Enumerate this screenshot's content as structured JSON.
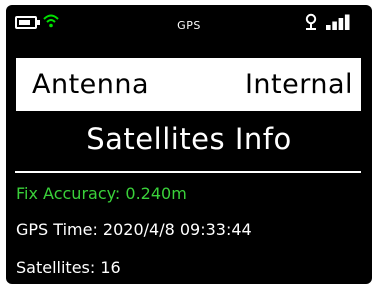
{
  "status_bar": {
    "title": "GPS",
    "battery_level": 0.8,
    "signal_bars": 4,
    "wifi_color": "#00e000"
  },
  "antenna": {
    "label": "Antenna",
    "value": "Internal"
  },
  "section_title": "Satellites Info",
  "info": {
    "fix_accuracy": "Fix Accuracy: 0.240m",
    "fix_color": "#3ad13a",
    "gps_time": "GPS Time: 2020/4/8 09:33:44",
    "satellites": "Satellites: 16"
  }
}
